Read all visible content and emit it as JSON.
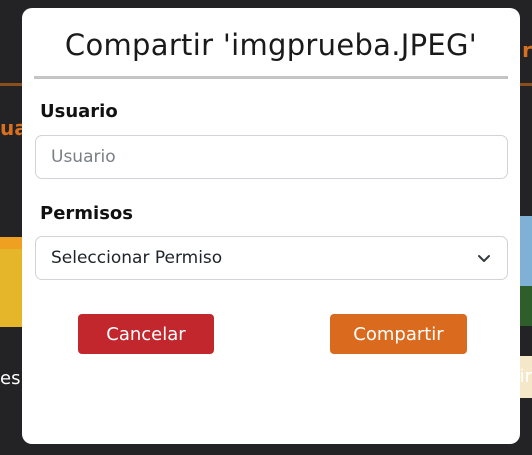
{
  "background": {
    "left_heading_fragment": "ual",
    "right_heading_fragment": "r",
    "left_label_fragment": "es",
    "right_label_fragment": "ir"
  },
  "modal": {
    "title": "Compartir 'imgprueba.JPEG'",
    "user_label": "Usuario",
    "user_placeholder": "Usuario",
    "user_value": "",
    "permission_label": "Permisos",
    "permission_selected": "Seleccionar Permiso",
    "cancel_label": "Cancelar",
    "share_label": "Compartir"
  },
  "icons": {
    "select_caret": "chevron-down-icon"
  },
  "colors": {
    "cancel": "#c1272d",
    "share": "#da6a1e",
    "accent": "#d9701f",
    "backdrop": "#232326"
  }
}
